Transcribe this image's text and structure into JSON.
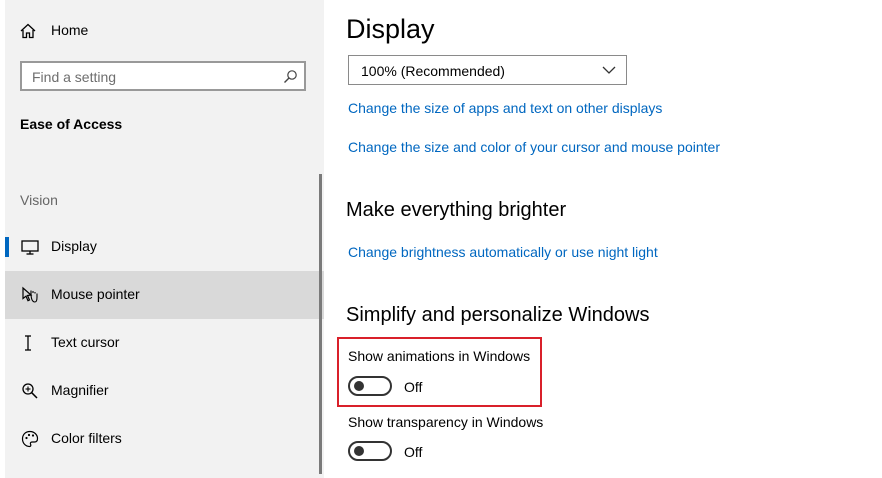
{
  "sidebar": {
    "home_label": "Home",
    "search_placeholder": "Find a setting",
    "section_title": "Ease of Access",
    "group_title": "Vision",
    "items": [
      {
        "label": "Display",
        "icon": "monitor-icon"
      },
      {
        "label": "Mouse pointer",
        "icon": "mouse-pointer-icon"
      },
      {
        "label": "Text cursor",
        "icon": "text-cursor-icon"
      },
      {
        "label": "Magnifier",
        "icon": "magnifier-icon"
      },
      {
        "label": "Color filters",
        "icon": "color-filters-icon"
      }
    ]
  },
  "main": {
    "title": "Display",
    "scale_dropdown": {
      "selected": "100% (Recommended)"
    },
    "links": {
      "apps_text_size": "Change the size of apps and text on other displays",
      "cursor_size": "Change the size and color of your cursor and mouse pointer",
      "brightness": "Change brightness automatically or use night light"
    },
    "brighter_heading": "Make everything brighter",
    "simplify_heading": "Simplify and personalize Windows",
    "settings": [
      {
        "label": "Show animations in Windows",
        "state": "Off"
      },
      {
        "label": "Show transparency in Windows",
        "state": "Off"
      }
    ]
  },
  "colors": {
    "accent": "#0067c0",
    "highlight_box": "#d9202a",
    "sidebar_bg": "#f2f2f2",
    "hover_bg": "#d9d9d9"
  }
}
